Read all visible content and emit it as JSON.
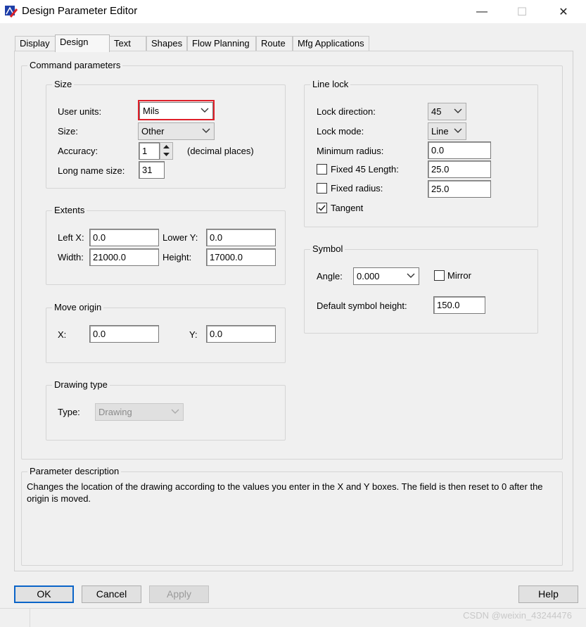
{
  "window": {
    "title": "Design Parameter Editor",
    "minimize_glyph": "—",
    "maximize_glyph": "☐",
    "close_glyph": "✕"
  },
  "tabs": [
    {
      "label": "Display"
    },
    {
      "label": "Design",
      "active": true
    },
    {
      "label": "Text"
    },
    {
      "label": "Shapes"
    },
    {
      "label": "Flow Planning"
    },
    {
      "label": "Route"
    },
    {
      "label": "Mfg Applications"
    }
  ],
  "command_parameters": {
    "title": "Command parameters",
    "size": {
      "title": "Size",
      "user_units_label": "User units:",
      "user_units_value": "Mils",
      "size_label": "Size:",
      "size_value": "Other",
      "accuracy_label": "Accuracy:",
      "accuracy_value": "1",
      "accuracy_suffix": "(decimal places)",
      "long_name_label": "Long name size:",
      "long_name_value": "31"
    },
    "extents": {
      "title": "Extents",
      "left_x_label": "Left X:",
      "left_x_value": "0.0",
      "lower_y_label": "Lower Y:",
      "lower_y_value": "0.0",
      "width_label": "Width:",
      "width_value": "21000.0",
      "height_label": "Height:",
      "height_value": "17000.0"
    },
    "move_origin": {
      "title": "Move origin",
      "x_label": "X:",
      "x_value": "0.0",
      "y_label": "Y:",
      "y_value": "0.0"
    },
    "drawing_type": {
      "title": "Drawing type",
      "type_label": "Type:",
      "type_value": "Drawing"
    },
    "line_lock": {
      "title": "Line lock",
      "direction_label": "Lock direction:",
      "direction_value": "45",
      "mode_label": "Lock mode:",
      "mode_value": "Line",
      "min_radius_label": "Minimum radius:",
      "min_radius_value": "0.0",
      "fixed45_label": "Fixed 45 Length:",
      "fixed45_checked": false,
      "fixed45_value": "25.0",
      "fixed_radius_label": "Fixed radius:",
      "fixed_radius_checked": false,
      "fixed_radius_value": "25.0",
      "tangent_label": "Tangent",
      "tangent_checked": true
    },
    "symbol": {
      "title": "Symbol",
      "angle_label": "Angle:",
      "angle_value": "0.000",
      "mirror_label": "Mirror",
      "mirror_checked": false,
      "height_label": "Default symbol height:",
      "height_value": "150.0"
    }
  },
  "parameter_description": {
    "title": "Parameter description",
    "text": "Changes the location of the drawing according to the values you enter in the X and Y boxes. The field is then reset to 0 after the origin is moved."
  },
  "buttons": {
    "ok": "OK",
    "cancel": "Cancel",
    "apply": "Apply",
    "help": "Help"
  },
  "watermark": "CSDN @weixin_43244476",
  "colors": {
    "highlight": "#e0202a",
    "default_button_border": "#0a64c8"
  }
}
